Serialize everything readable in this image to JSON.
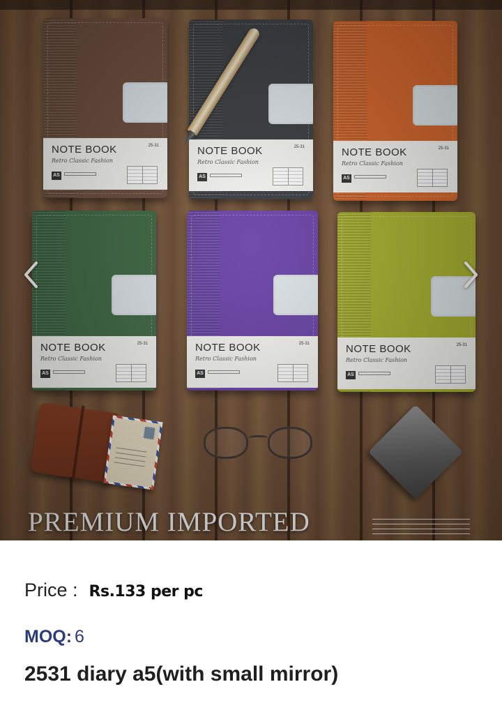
{
  "product_image": {
    "banner_text": "PREMIUM IMPORTED",
    "notebooks": [
      {
        "color": "#6b4d3c",
        "title": "NOTE BOOK",
        "subtitle": "Retro Classic Fashion",
        "code": "25-31",
        "badge": "AS"
      },
      {
        "color": "#3a3d40",
        "title": "NOTE BOOK",
        "subtitle": "Retro Classic Fashion",
        "code": "25-31",
        "badge": "AS"
      },
      {
        "color": "#d5652a",
        "title": "NOTE BOOK",
        "subtitle": "Retro Classic Fashion",
        "code": "25-31",
        "badge": "AS"
      },
      {
        "color": "#3f6a45",
        "title": "NOTE BOOK",
        "subtitle": "Retro Classic Fashion",
        "code": "25-31",
        "badge": "AS"
      },
      {
        "color": "#6a44a8",
        "title": "NOTE BOOK",
        "subtitle": "Retro Classic Fashion",
        "code": "25-31",
        "badge": "AS"
      },
      {
        "color": "#a9b42e",
        "title": "NOTE BOOK",
        "subtitle": "Retro Classic Fashion",
        "code": "25-31",
        "badge": "AS"
      }
    ]
  },
  "carousel": {
    "prev_icon": "chevron-left-icon",
    "next_icon": "chevron-right-icon"
  },
  "price": {
    "label": "Price :",
    "value": "Rs.133 per pc"
  },
  "moq": {
    "label": "MOQ:",
    "value": "6"
  },
  "product": {
    "title": "2531 diary a5(with small mirror)"
  },
  "colors": {
    "moq_accent": "#2b3b7a",
    "arrow": "#ffffff"
  }
}
